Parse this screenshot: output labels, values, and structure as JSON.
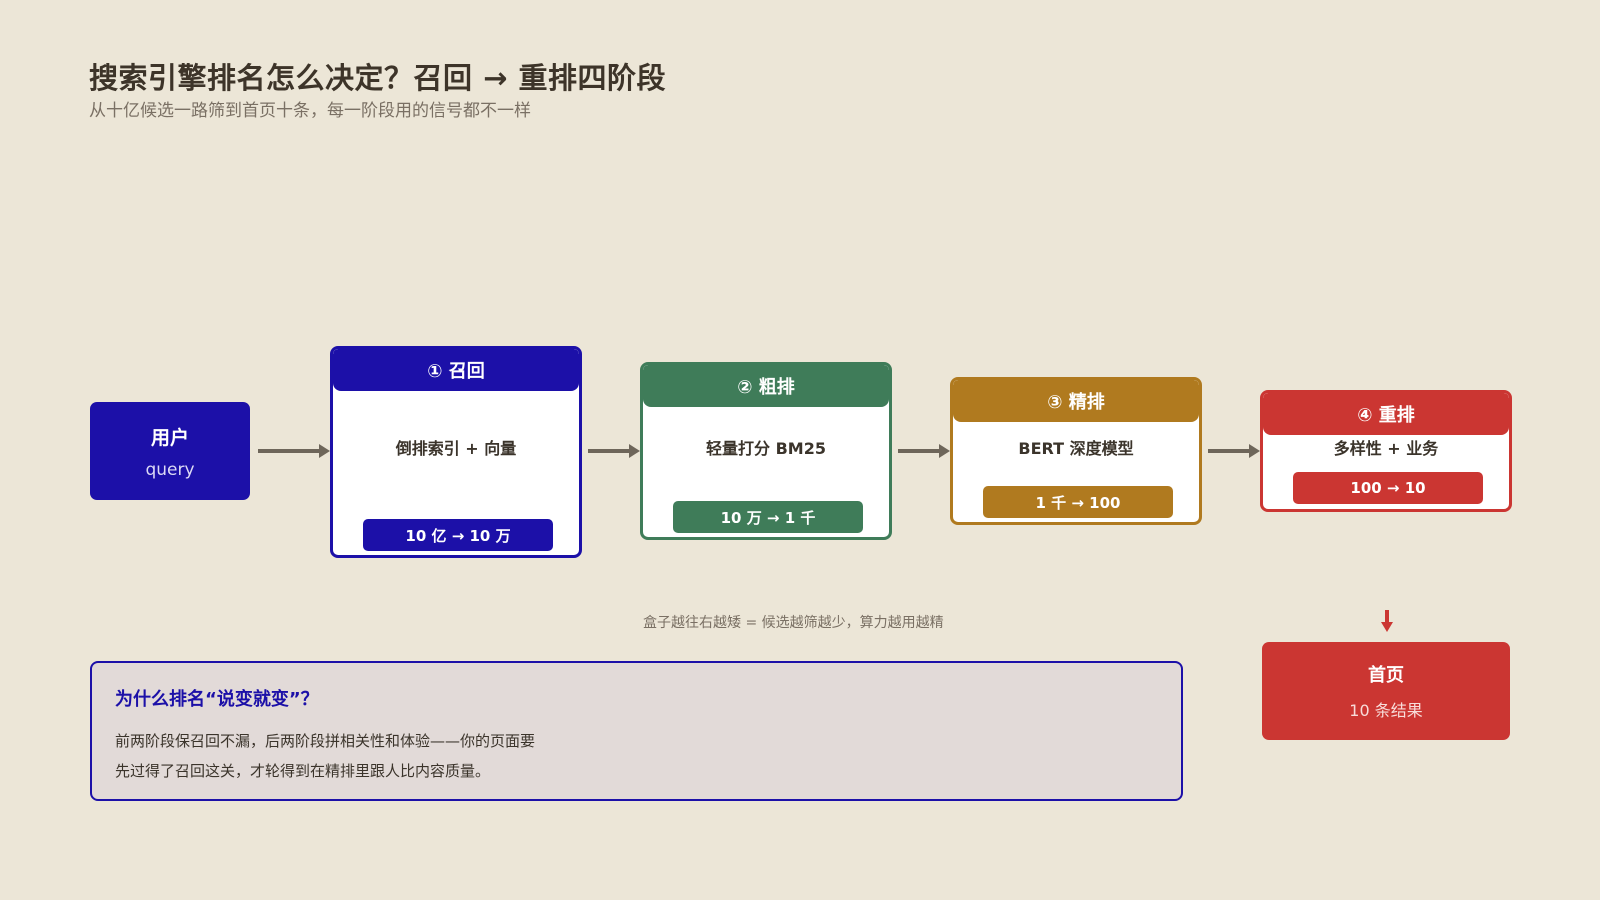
{
  "header": {
    "title": "搜索引擎排名怎么决定？召回 → 重排四阶段",
    "subtitle": "从十亿候选一路筛到首页十条，每一阶段用的信号都不一样"
  },
  "user": {
    "label": "用户",
    "sub": "query"
  },
  "stages": [
    {
      "title": "① 召回",
      "desc": "倒排索引 + 向量",
      "count": "10 亿 → 10 万",
      "color": "#1c10a8"
    },
    {
      "title": "② 粗排",
      "desc": "轻量打分 BM25",
      "count": "10 万 → 1 千",
      "color": "#3f7c59"
    },
    {
      "title": "③ 精排",
      "desc": "BERT 深度模型",
      "count": "1 千 → 100",
      "color": "#b07a1f"
    },
    {
      "title": "④ 重排",
      "desc": "多样性 + 业务",
      "count": "100 → 10",
      "color": "#cb3632"
    }
  ],
  "note": "盒子越往右越矮 = 候选越筛越少，算力越用越精",
  "result": {
    "label": "首页",
    "sub": "10 条结果"
  },
  "why": {
    "title": "为什么排名“说变就变”？",
    "line1": "前两阶段保召回不漏，后两阶段拼相关性和体验——你的页面要",
    "line2": "先过得了召回这关，才轮得到在精排里跟人比内容质量。"
  },
  "colors": {
    "background": "#ece6d7",
    "user": "#1c10a8",
    "arrow": "#6e665a",
    "result": "#cb3632"
  }
}
